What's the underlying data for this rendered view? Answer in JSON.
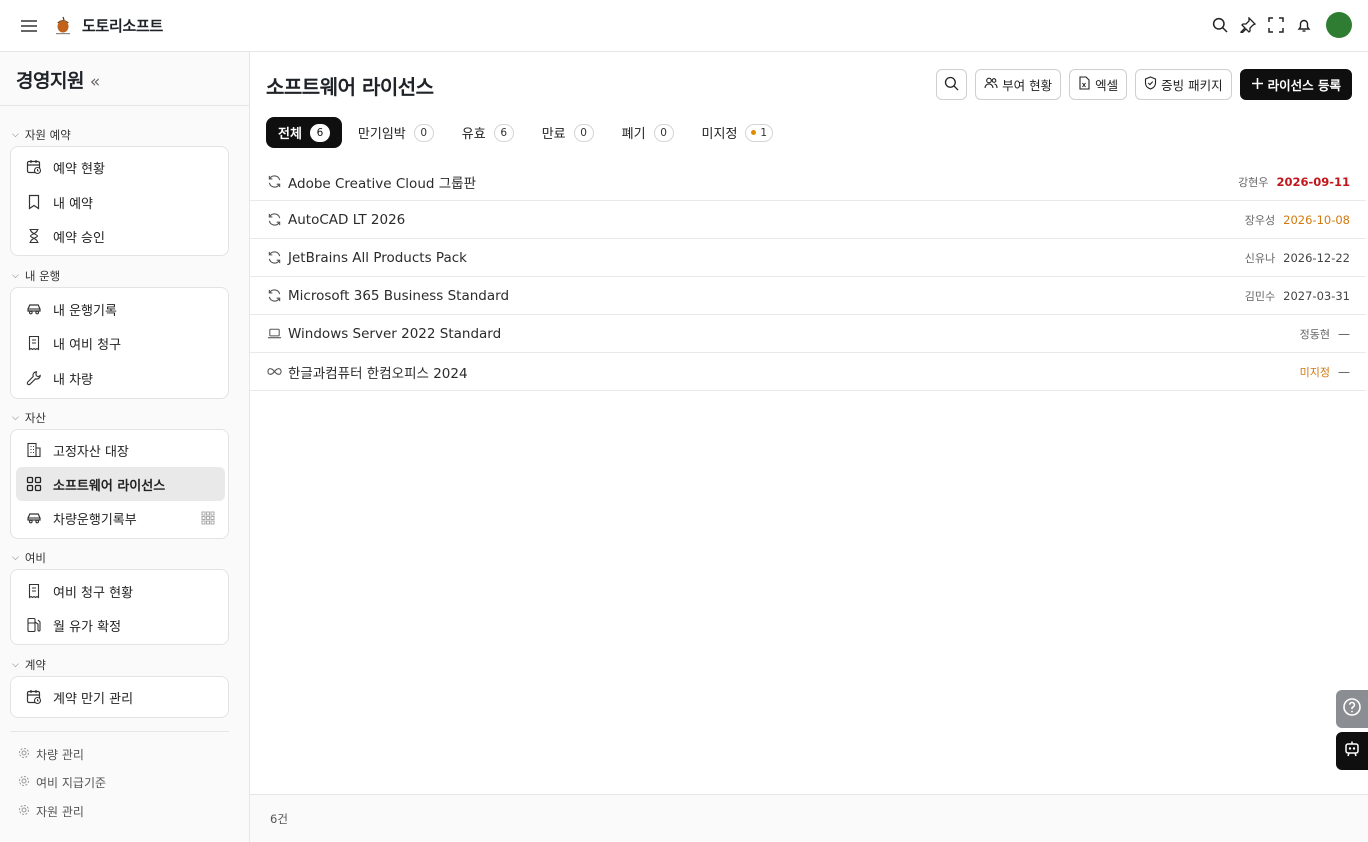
{
  "app": {
    "brand": "도토리소프트"
  },
  "sidebar": {
    "title": "경영지원",
    "collapse": "«",
    "sections": [
      {
        "label": "자원 예약",
        "items": [
          {
            "label": "예약 현황",
            "icon": "calendar-clock-icon"
          },
          {
            "label": "내 예약",
            "icon": "bookmark-icon"
          },
          {
            "label": "예약 승인",
            "icon": "hourglass-icon"
          }
        ]
      },
      {
        "label": "내 운행",
        "items": [
          {
            "label": "내 운행기록",
            "icon": "car-icon"
          },
          {
            "label": "내 여비 청구",
            "icon": "receipt-icon"
          },
          {
            "label": "내 차량",
            "icon": "wrench-icon"
          }
        ]
      },
      {
        "label": "자산",
        "items": [
          {
            "label": "고정자산 대장",
            "icon": "building-icon"
          },
          {
            "label": "소프트웨어 라이선스",
            "icon": "grid-icon",
            "active": true
          },
          {
            "label": "차량운행기록부",
            "icon": "car-icon"
          }
        ]
      },
      {
        "label": "여비",
        "items": [
          {
            "label": "여비 청구 현황",
            "icon": "receipt-icon"
          },
          {
            "label": "월 유가 확정",
            "icon": "fuel-icon"
          }
        ]
      },
      {
        "label": "계약",
        "items": [
          {
            "label": "계약 만기 관리",
            "icon": "calendar-clock-icon"
          }
        ]
      }
    ],
    "footer": [
      {
        "label": "차량 관리"
      },
      {
        "label": "여비 지급기준"
      },
      {
        "label": "자원 관리"
      }
    ]
  },
  "main": {
    "title": "소프트웨어 라이선스",
    "actions": {
      "assign": "부여 현황",
      "excel": "엑셀",
      "evidence": "증빙 패키지",
      "register": "라이선스 등록"
    },
    "tabs": [
      {
        "label": "전체",
        "count": "6",
        "active": true
      },
      {
        "label": "만기임박",
        "count": "0"
      },
      {
        "label": "유효",
        "count": "6"
      },
      {
        "label": "만료",
        "count": "0"
      },
      {
        "label": "폐기",
        "count": "0"
      },
      {
        "label": "미지정",
        "count": "1"
      }
    ],
    "rows": [
      {
        "name": "Adobe Creative Cloud 그룹판",
        "owner": "강현우",
        "date": "2026-09-11",
        "type": "subscription"
      },
      {
        "name": "AutoCAD LT 2026",
        "owner": "장우성",
        "date": "2026-10-08",
        "type": "subscription"
      },
      {
        "name": "JetBrains All Products Pack",
        "owner": "신유나",
        "date": "2026-12-22",
        "type": "subscription"
      },
      {
        "name": "Microsoft 365 Business Standard",
        "owner": "김민수",
        "date": "2027-03-31",
        "type": "subscription"
      },
      {
        "name": "Windows Server 2022 Standard",
        "owner": "정동현",
        "date": "—",
        "type": "device"
      },
      {
        "name": "한글과컴퓨터 한컴오피스 2024",
        "owner": "미지정",
        "date": "—",
        "type": "perpetual"
      }
    ],
    "footer_count": "6건"
  },
  "colors": {
    "urgent": "#c0161c",
    "warning": "#d07a10",
    "avatar": "#2e7d32"
  }
}
